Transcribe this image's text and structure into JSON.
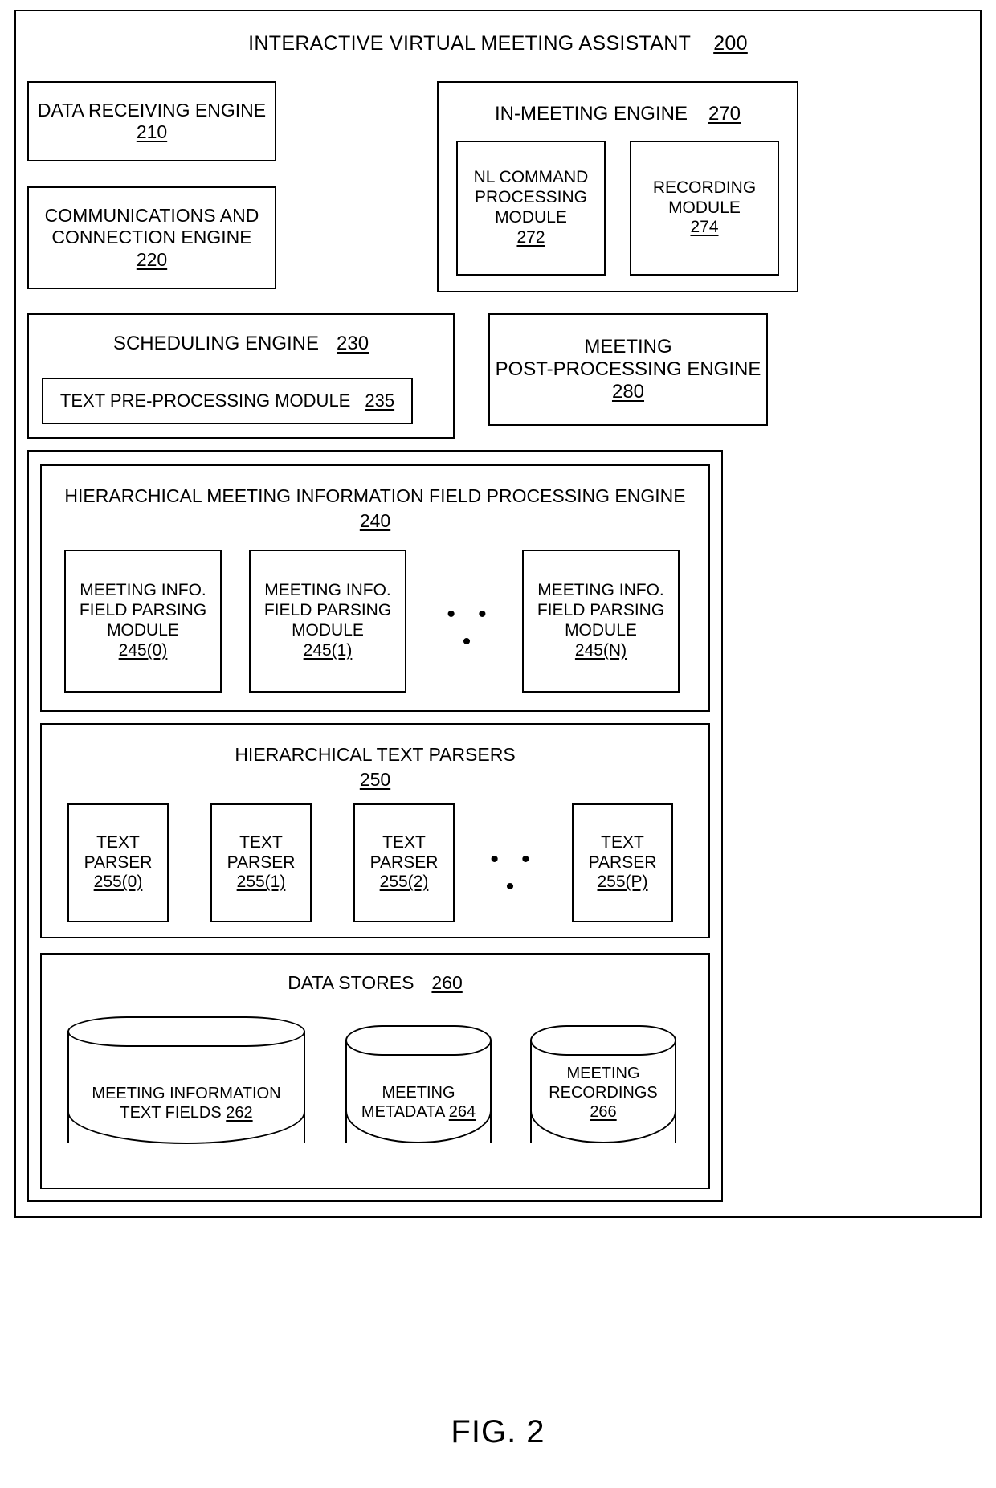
{
  "figure": {
    "caption": "FIG. 2",
    "title": "INTERACTIVE VIRTUAL MEETING ASSISTANT",
    "title_ref": "200"
  },
  "blocks": {
    "data_receiving_engine": {
      "label": "DATA RECEIVING ENGINE",
      "ref": "210"
    },
    "communications_engine": {
      "label_line1": "COMMUNICATIONS AND",
      "label_line2": "CONNECTION ENGINE",
      "ref": "220"
    },
    "in_meeting_engine": {
      "label": "IN-MEETING ENGINE",
      "ref": "270"
    },
    "nl_command_module": {
      "label_line1": "NL COMMAND",
      "label_line2": "PROCESSING",
      "label_line3": "MODULE",
      "ref": "272"
    },
    "recording_module": {
      "label_line1": "RECORDING",
      "label_line2": "MODULE",
      "ref": "274"
    },
    "scheduling_engine": {
      "label": "SCHEDULING ENGINE",
      "ref": "230"
    },
    "text_preprocessing_module": {
      "label": "TEXT PRE-PROCESSING MODULE",
      "ref": "235"
    },
    "post_processing_engine": {
      "label_line1": "MEETING",
      "label_line2": "POST-PROCESSING ENGINE",
      "ref": "280"
    },
    "field_processing_engine": {
      "label": "HIERARCHICAL MEETING INFORMATION FIELD PROCESSING ENGINE",
      "ref": "240"
    },
    "text_parsers": {
      "label": "HIERARCHICAL TEXT PARSERS",
      "ref": "250"
    },
    "data_stores": {
      "label": "DATA STORES",
      "ref": "260"
    }
  },
  "parsing_modules": {
    "ellipsis": "• • •",
    "items": [
      {
        "line1": "MEETING INFO.",
        "line2": "FIELD PARSING",
        "line3": "MODULE",
        "ref": "245(0)"
      },
      {
        "line1": "MEETING INFO.",
        "line2": "FIELD PARSING",
        "line3": "MODULE",
        "ref": "245(1)"
      },
      {
        "line1": "MEETING INFO.",
        "line2": "FIELD PARSING",
        "line3": "MODULE",
        "ref": "245(N)"
      }
    ]
  },
  "parsers": {
    "ellipsis": "• • •",
    "items": [
      {
        "line1": "TEXT",
        "line2": "PARSER",
        "ref": "255(0)"
      },
      {
        "line1": "TEXT",
        "line2": "PARSER",
        "ref": "255(1)"
      },
      {
        "line1": "TEXT",
        "line2": "PARSER",
        "ref": "255(2)"
      },
      {
        "line1": "TEXT",
        "line2": "PARSER",
        "ref": "255(P)"
      }
    ]
  },
  "data_store_items": [
    {
      "line1": "MEETING INFORMATION",
      "line2": "TEXT FIELDS",
      "ref": "262"
    },
    {
      "line1": "MEETING",
      "line2": "METADATA",
      "ref": "264"
    },
    {
      "line1": "MEETING",
      "line2": "RECORDINGS",
      "ref": "266"
    }
  ]
}
